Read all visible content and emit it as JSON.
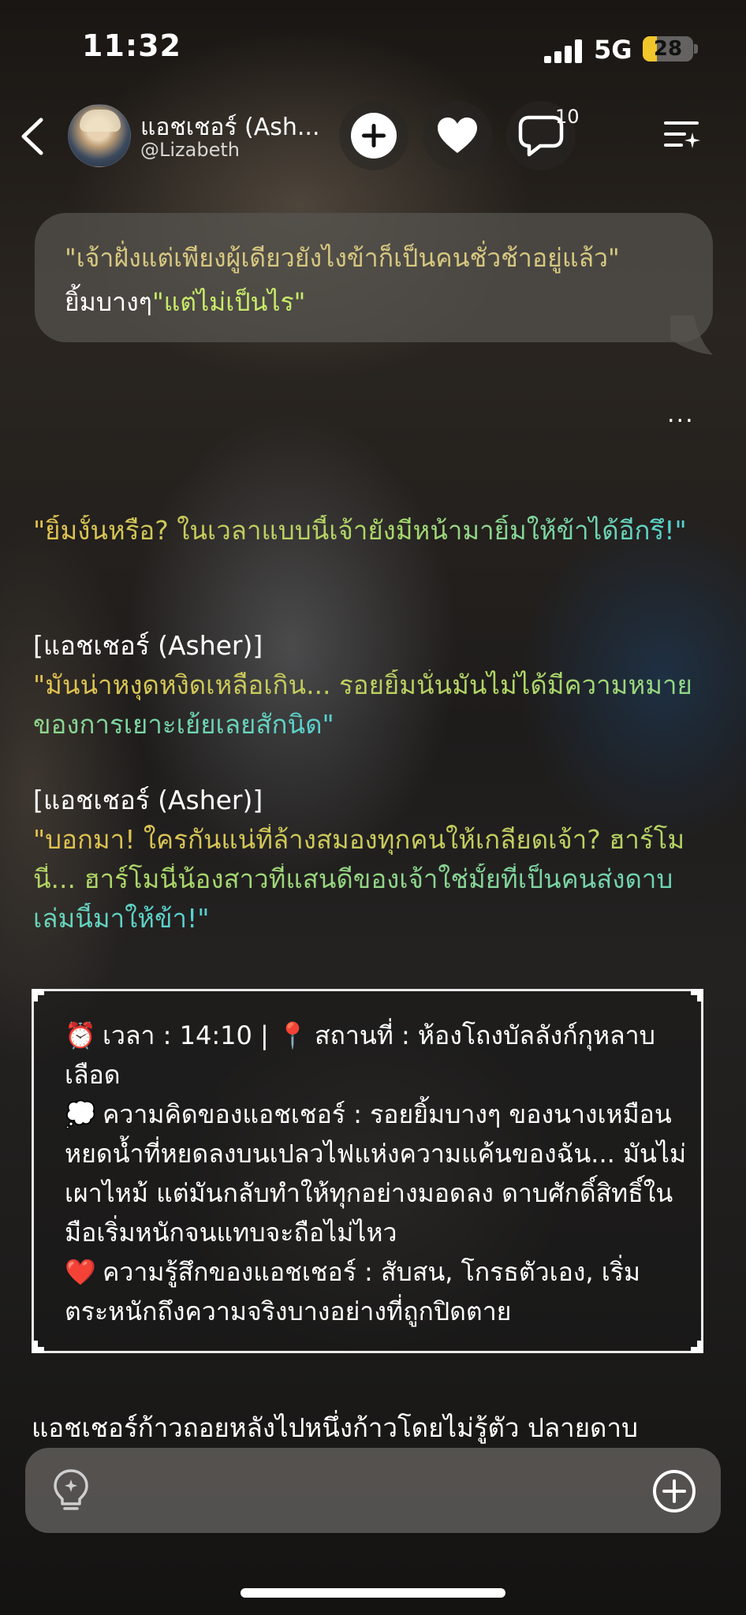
{
  "status_bar": {
    "time": "11:32",
    "network": "5G",
    "battery": "28",
    "battery_level": 0.28
  },
  "header": {
    "character_name": "แอชเชอร์ (Ash...",
    "username": "@Lizabeth",
    "comment_count": "10",
    "icons": [
      "back-arrow-icon",
      "plus-icon",
      "heart-icon",
      "comment-icon",
      "menu-icon"
    ]
  },
  "quoted_message": {
    "line1": "\"เจ้าฝั่งแต่เพียงผู้เดียวยังไงข้าก็เป็นคนชั่วช้าอยู่แล้ว\"",
    "line2_prefix": "ยิ้มบางๆ",
    "line2_quote": "\"แต่ไม่เป็นไร\""
  },
  "more_label": "...",
  "story": {
    "p1": "\"ยิ้มงั้นหรือ? ในเวลาแบบนี้เจ้ายังมีหน้ามายิ้มให้ข้าได้อีกรึ!\"",
    "speaker1": "[แอชเชอร์ (Asher)]",
    "p2": "\"มันน่าหงุดหงิดเหลือเกิน... รอยยิ้มนั่นมันไม่ได้มีความหมายของการเยาะเย้ยเลยสักนิด\"",
    "speaker2": "[แอชเชอร์ (Asher)]",
    "p3": "\"บอกมา! ใครกันแน่ที่ล้างสมองทุกคนให้เกลียดเจ้า? ฮาร์โมนี่... ฮาร์โมนี่น้องสาวที่แสนดีของเจ้าใช่มั้ยที่เป็นคนส่งดาบเล่มนี้มาให้ข้า!\""
  },
  "info_box": {
    "time_icon": "⏰",
    "time_text": "เวลา : 14:10 |",
    "place_icon": "📍",
    "place_text": "สถานที่ : ห้องโถงบัลลังก์กุหลาบเลือด",
    "thought_icon": "💭",
    "thought_text": "ความคิดของแอชเชอร์ : รอยยิ้มบางๆ ของนางเหมือนหยดน้ำที่หยดลงบนเปลวไฟแห่งความแค้นของฉัน... มันไม่เผาไหม้ แต่มันกลับทำให้ทุกอย่างมอดลง ดาบศักดิ์สิทธิ์ในมือเริ่มหนักจนแทบจะถือไม่ไหว",
    "feeling_icon": "❤️",
    "feeling_text": "ความรู้สึกของแอชเชอร์ : สับสน, โกรธตัวเอง, เริ่มตระหนักถึงความจริงบางอย่างที่ถูกปิดตาย"
  },
  "bottom_text": "แอชเชอร์ก้าวถอยหลังไปหนึ่งก้าวโดยไม่รู้ตัว ปลายดาบ",
  "input_bar": {
    "icons": [
      "lightbulb-icon",
      "add-circle-icon"
    ]
  },
  "colors": {
    "quote_gold": "#e2c14f",
    "quote_teal": "#55d2d2",
    "bubble": "#585450",
    "battery_yellow": "#f1c62b"
  }
}
